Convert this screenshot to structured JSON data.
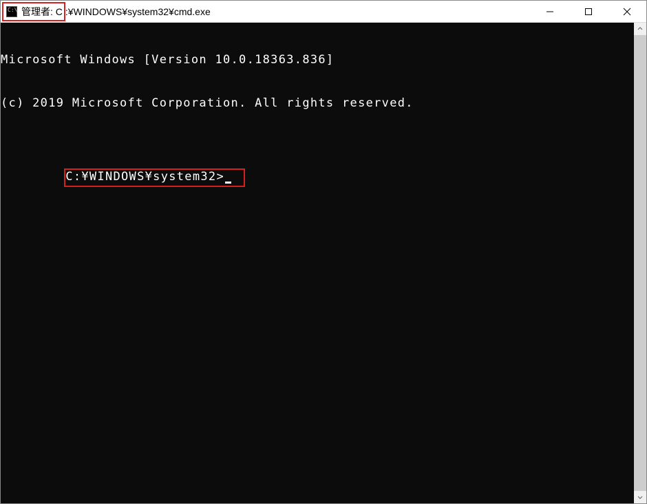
{
  "window": {
    "title_highlighted": "管理者: C",
    "title_remainder": ":¥WINDOWS¥system32¥cmd.exe"
  },
  "terminal": {
    "line1": "Microsoft Windows [Version 10.0.18363.836]",
    "line2": "(c) 2019 Microsoft Corporation. All rights reserved.",
    "prompt": "C:¥WINDOWS¥system32>"
  },
  "icons": {
    "app_glyph": "C:\\"
  }
}
